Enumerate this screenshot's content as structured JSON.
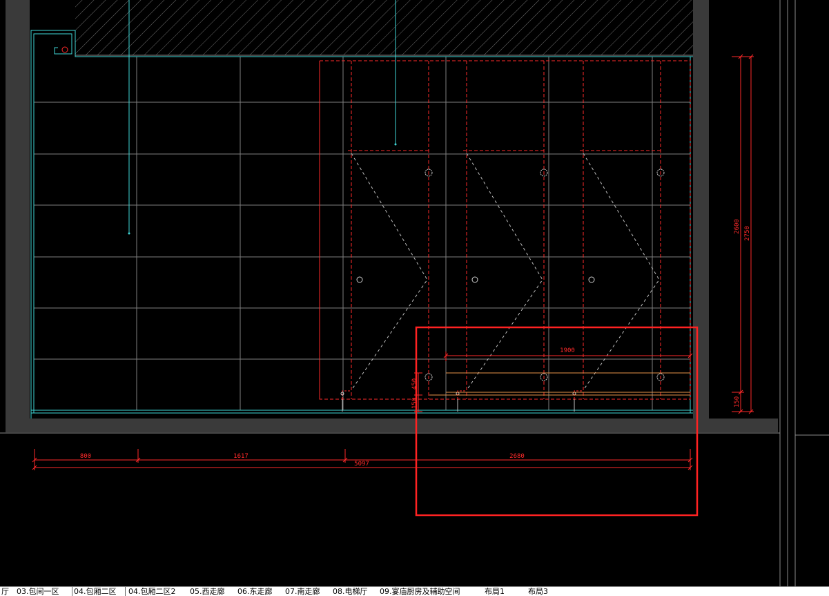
{
  "drawing": {
    "dimensions": {
      "seg_800": "800",
      "seg_1617": "1617",
      "seg_2680": "2680",
      "total_5097": "5097",
      "width_1900": "1900",
      "v_2600": "2600",
      "v_2750": "2750",
      "v_150_right": "150",
      "v_450": "450",
      "v_150_left": "150"
    },
    "colors": {
      "cyan": "#3fd7d7",
      "red": "#ff2a2a",
      "orange": "#e8934a",
      "grid": "#7f7f7f",
      "wall": "#3a3a3a",
      "highlight": "#ff2222"
    }
  },
  "tabs": [
    {
      "label": "厅"
    },
    {
      "label": "03.包间一区"
    },
    {
      "label": "04.包厢二区"
    },
    {
      "label": "04.包厢二区2"
    },
    {
      "label": "05.西走廊"
    },
    {
      "label": "06.东走廊"
    },
    {
      "label": "07.南走廊"
    },
    {
      "label": "08.电梯厅"
    },
    {
      "label": "09.宴庙厨房及辅助空间"
    },
    {
      "label": "布局1"
    },
    {
      "label": "布局3"
    }
  ],
  "active_tab_index": 2
}
